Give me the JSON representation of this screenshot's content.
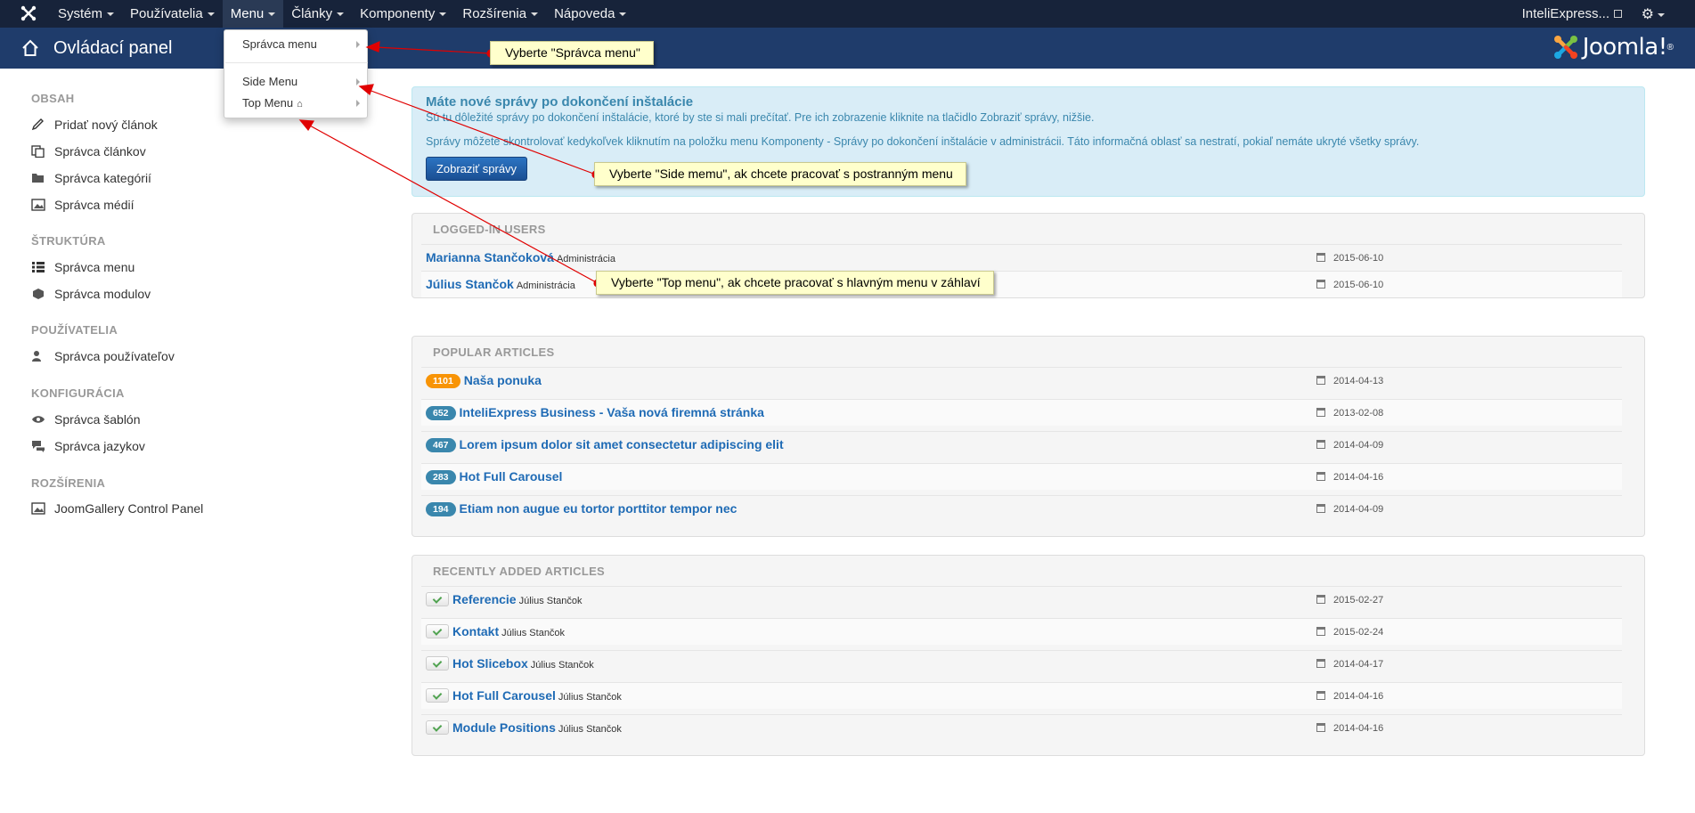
{
  "navbar": {
    "menus": [
      {
        "label": "Systém"
      },
      {
        "label": "Používatelia"
      },
      {
        "label": "Menu"
      },
      {
        "label": "Články"
      },
      {
        "label": "Komponenty"
      },
      {
        "label": "Rozšírenia"
      },
      {
        "label": "Nápoveda"
      }
    ],
    "active_menu": "Menu",
    "site_link": "InteliExpress...",
    "icons": {
      "logo": "joomla-logo-icon",
      "settings": "gear-icon",
      "external": "external-link-icon"
    }
  },
  "header": {
    "title": "Ovládací panel",
    "brand": "Joomla!",
    "brand_sup": "®"
  },
  "dropdown": {
    "items": [
      {
        "label": "Správca menu"
      },
      {
        "label": "Side Menu"
      },
      {
        "label": "Top Menu"
      }
    ]
  },
  "sidebar": {
    "sections": [
      {
        "title": "OBSAH",
        "links": [
          "Pridať nový článok",
          "Správca článkov",
          "Správca kategórií",
          "Správca médií"
        ]
      },
      {
        "title": "ŠTRUKTÚRA",
        "links": [
          "Správca menu",
          "Správca modulov"
        ]
      },
      {
        "title": "POUŽÍVATELIA",
        "links": [
          "Správca používateľov"
        ]
      },
      {
        "title": "KONFIGURÁCIA",
        "links": [
          "Správca šablón",
          "Správca jazykov"
        ]
      },
      {
        "title": "ROZŠÍRENIA",
        "links": [
          "JoomGallery Control Panel"
        ]
      }
    ]
  },
  "alert": {
    "title": "Máte nové správy po dokončení inštalácie",
    "p1": "Sú tu dôležité správy po dokončení inštalácie, ktoré by ste si mali prečítať. Pre ich zobrazenie kliknite na tlačidlo Zobraziť správy, nižšie.",
    "p2": "Správy môžete skontrolovať kedykoľvek kliknutím na položku menu Komponenty - Správy po dokončení inštalácie v administrácii. Táto informačná oblasť sa nestratí, pokiaľ nemáte ukryté všetky správy.",
    "button": "Zobraziť správy"
  },
  "logged_in": {
    "title": "LOGGED-IN USERS",
    "rows": [
      {
        "name": "Marianna Stančoková",
        "role": "Administrácia",
        "date": "2015-06-10"
      },
      {
        "name": "Július Stančok",
        "role": "Administrácia",
        "date": "2015-06-10"
      }
    ]
  },
  "popular": {
    "title": "POPULAR ARTICLES",
    "rows": [
      {
        "hits": "1101",
        "badge_color": "#f89406",
        "title": "Naša ponuka",
        "date": "2014-04-13"
      },
      {
        "hits": "652",
        "badge_color": "#3a87ad",
        "title": "InteliExpress Business - Vaša nová firemná stránka",
        "date": "2013-02-08"
      },
      {
        "hits": "467",
        "badge_color": "#3a87ad",
        "title": "Lorem ipsum dolor sit amet consectetur adipiscing elit",
        "date": "2014-04-09"
      },
      {
        "hits": "283",
        "badge_color": "#3a87ad",
        "title": "Hot Full Carousel",
        "date": "2014-04-16"
      },
      {
        "hits": "194",
        "badge_color": "#3a87ad",
        "title": "Etiam non augue eu tortor porttitor tempor nec",
        "date": "2014-04-09"
      }
    ]
  },
  "recent": {
    "title": "RECENTLY ADDED ARTICLES",
    "rows": [
      {
        "title": "Referencie",
        "author": "Július Stančok",
        "date": "2015-02-27"
      },
      {
        "title": "Kontakt",
        "author": "Július Stančok",
        "date": "2015-02-24"
      },
      {
        "title": "Hot Slicebox",
        "author": "Július Stančok",
        "date": "2014-04-17"
      },
      {
        "title": "Hot Full Carousel",
        "author": "Július Stančok",
        "date": "2014-04-16"
      },
      {
        "title": "Module Positions",
        "author": "Július Stančok",
        "date": "2014-04-16"
      }
    ]
  },
  "callouts": {
    "c1": "Vyberte \"Správca menu\"",
    "c2": "Vyberte \"Side memu\", ak chcete pracovať s postranným menu",
    "c3": "Vyberte \"Top menu\", ak chcete pracovať s hlavným menu v záhlaví"
  },
  "colors": {
    "navbar": "#17233a",
    "header": "#1f3c6b",
    "link": "#1f6bb5",
    "alert": "#d9edf7",
    "callout": "#ffffcc",
    "arrow": "#e00000"
  }
}
